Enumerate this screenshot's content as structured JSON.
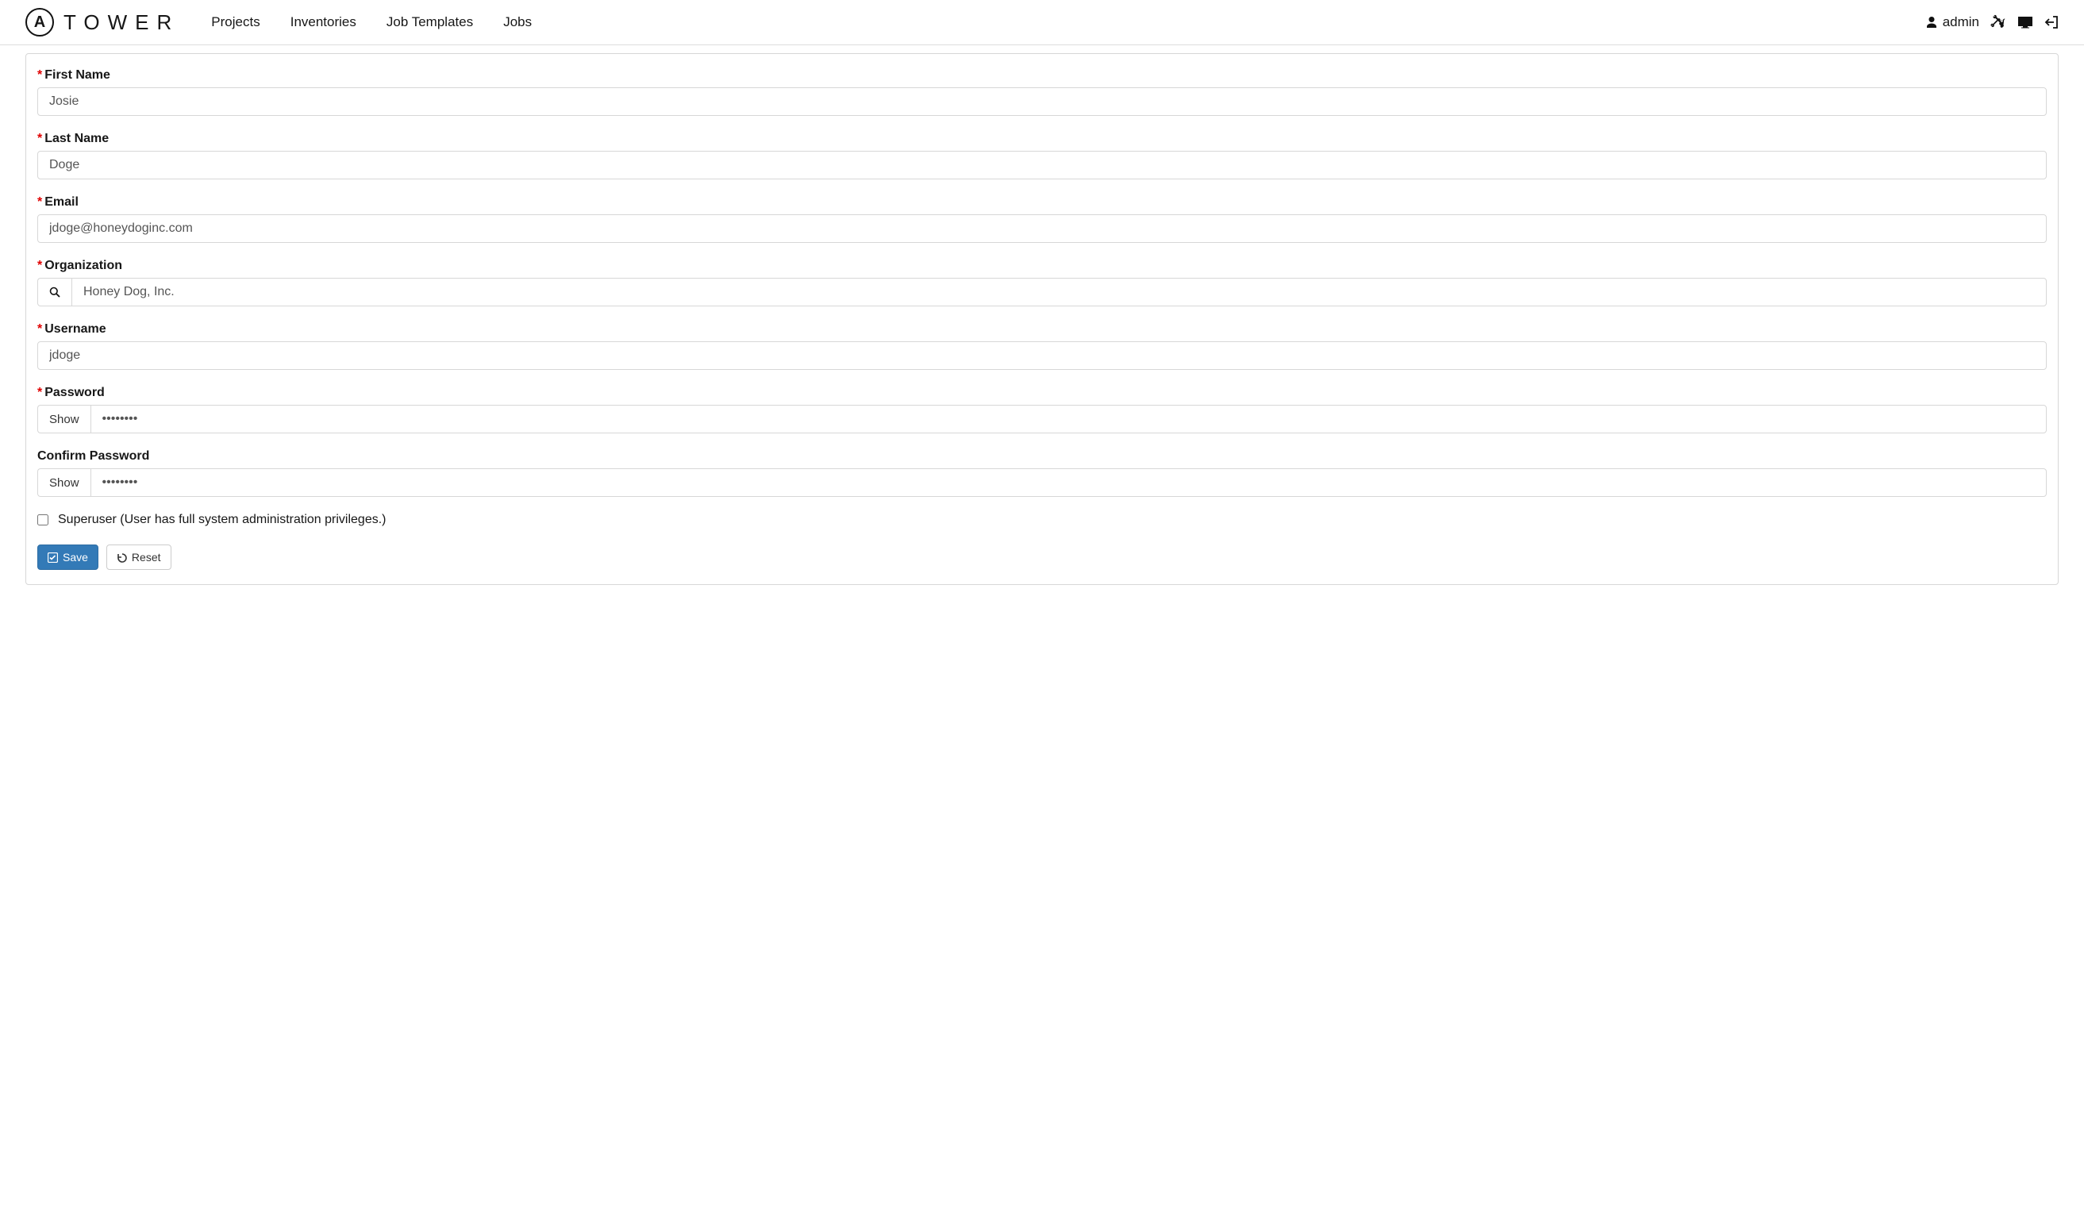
{
  "header": {
    "brand": "TOWER",
    "nav": {
      "projects": "Projects",
      "inventories": "Inventories",
      "job_templates": "Job Templates",
      "jobs": "Jobs"
    },
    "user": "admin"
  },
  "form": {
    "first_name": {
      "label": "First Name",
      "value": "Josie",
      "required": true
    },
    "last_name": {
      "label": "Last Name",
      "value": "Doge",
      "required": true
    },
    "email": {
      "label": "Email",
      "value": "jdoge@honeydoginc.com",
      "required": true
    },
    "organization": {
      "label": "Organization",
      "value": "Honey Dog, Inc.",
      "required": true
    },
    "username": {
      "label": "Username",
      "value": "jdoge",
      "required": true
    },
    "password": {
      "label": "Password",
      "show_label": "Show",
      "value": "••••••••",
      "required": true
    },
    "confirm_password": {
      "label": "Confirm Password",
      "show_label": "Show",
      "value": "••••••••",
      "required": false
    },
    "superuser": {
      "label": "Superuser (User has full system administration privileges.)",
      "checked": false
    }
  },
  "buttons": {
    "save": "Save",
    "reset": "Reset"
  }
}
